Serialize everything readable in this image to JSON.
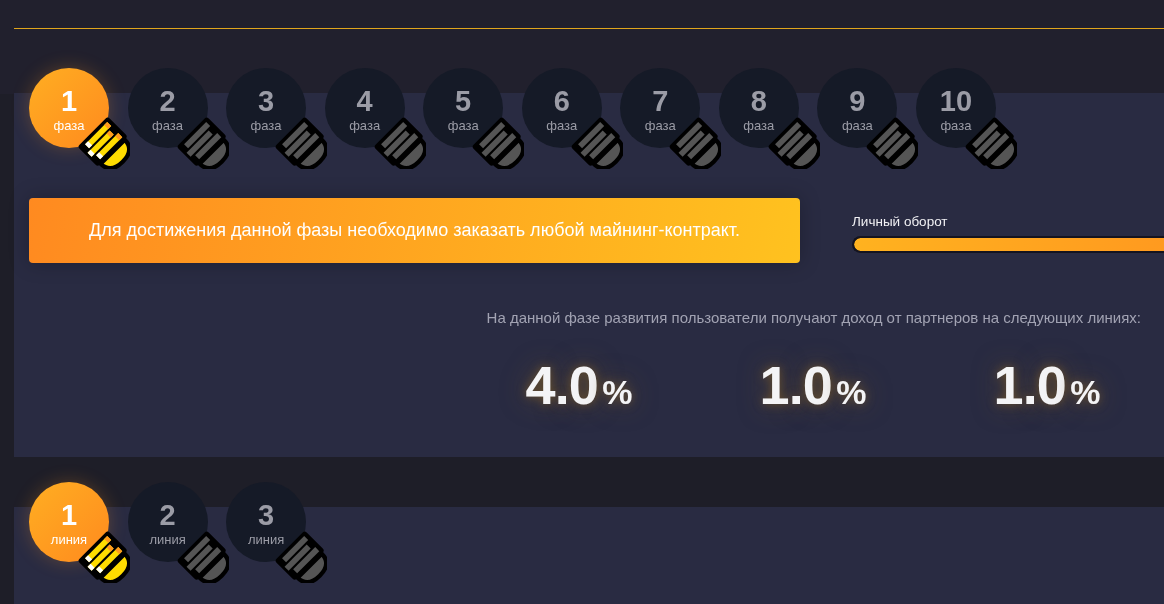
{
  "phases": [
    {
      "number": "1",
      "label": "фаза",
      "selected": true
    },
    {
      "number": "2",
      "label": "фаза",
      "selected": false
    },
    {
      "number": "3",
      "label": "фаза",
      "selected": false
    },
    {
      "number": "4",
      "label": "фаза",
      "selected": false
    },
    {
      "number": "5",
      "label": "фаза",
      "selected": false
    },
    {
      "number": "6",
      "label": "фаза",
      "selected": false
    },
    {
      "number": "7",
      "label": "фаза",
      "selected": false
    },
    {
      "number": "8",
      "label": "фаза",
      "selected": false
    },
    {
      "number": "9",
      "label": "фаза",
      "selected": false
    },
    {
      "number": "10",
      "label": "фаза",
      "selected": false
    }
  ],
  "notice": "Для достижения данной фазы необходимо заказать любой майнинг-контракт.",
  "turnover": {
    "label": "Личный оборот",
    "level": 1
  },
  "income": {
    "caption": "На данной фазе развития пользователи получают доход от партнеров на следующих линиях:",
    "lines": [
      {
        "value": "4.0",
        "unit": "%"
      },
      {
        "value": "1.0",
        "unit": "%"
      },
      {
        "value": "1.0",
        "unit": "%"
      }
    ]
  },
  "line_tabs": [
    {
      "number": "1",
      "label": "линия",
      "selected": true
    },
    {
      "number": "2",
      "label": "линия",
      "selected": false
    },
    {
      "number": "3",
      "label": "линия",
      "selected": false
    }
  ]
}
